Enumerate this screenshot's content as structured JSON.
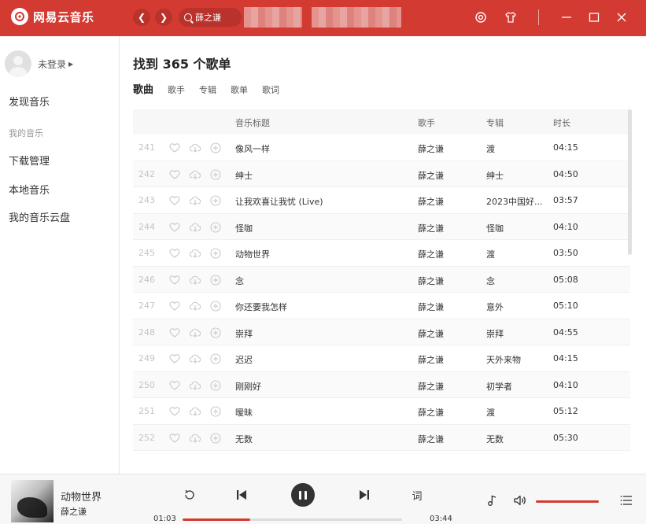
{
  "app": {
    "name": "网易云音乐",
    "accent_color": "#d33a31"
  },
  "search": {
    "query": "薛之谦"
  },
  "sidebar": {
    "login_text": "未登录",
    "discover": "发现音乐",
    "my_music_group": "我的音乐",
    "items": [
      "下载管理",
      "本地音乐",
      "我的音乐云盘"
    ]
  },
  "main": {
    "result_title": "找到 365 个歌单",
    "tabs": [
      "歌曲",
      "歌手",
      "专辑",
      "歌单",
      "歌词"
    ],
    "active_tab": "歌曲",
    "columns": {
      "title": "音乐标题",
      "artist": "歌手",
      "album": "专辑",
      "duration": "时长"
    },
    "rows": [
      {
        "index": "241",
        "title": "像风一样",
        "artist": "薛之谦",
        "album": "渡",
        "duration": "04:15"
      },
      {
        "index": "242",
        "title": "绅士",
        "artist": "薛之谦",
        "album": "绅士",
        "duration": "04:50"
      },
      {
        "index": "243",
        "title": "让我欢喜让我忧 (Live)",
        "artist": "薛之谦",
        "album": "2023中国好...",
        "duration": "03:57"
      },
      {
        "index": "244",
        "title": "怪咖",
        "artist": "薛之谦",
        "album": "怪咖",
        "duration": "04:10"
      },
      {
        "index": "245",
        "title": "动物世界",
        "artist": "薛之谦",
        "album": "渡",
        "duration": "03:50"
      },
      {
        "index": "246",
        "title": "念",
        "artist": "薛之谦",
        "album": "念",
        "duration": "05:08"
      },
      {
        "index": "247",
        "title": "你还要我怎样",
        "artist": "薛之谦",
        "album": "意外",
        "duration": "05:10"
      },
      {
        "index": "248",
        "title": "崇拜",
        "artist": "薛之谦",
        "album": "崇拜",
        "duration": "04:55"
      },
      {
        "index": "249",
        "title": "迟迟",
        "artist": "薛之谦",
        "album": "天外来物",
        "duration": "04:15"
      },
      {
        "index": "250",
        "title": "刚刚好",
        "artist": "薛之谦",
        "album": "初学者",
        "duration": "04:10"
      },
      {
        "index": "251",
        "title": "暧昧",
        "artist": "薛之谦",
        "album": "渡",
        "duration": "05:12"
      },
      {
        "index": "252",
        "title": "无数",
        "artist": "薛之谦",
        "album": "无数",
        "duration": "05:30"
      }
    ]
  },
  "player": {
    "song_name": "动物世界",
    "artist": "薛之谦",
    "current_time": "01:03",
    "total_time": "03:44",
    "lyrics_label": "词",
    "progress_fraction": 0.31,
    "volume_fraction": 1.0
  }
}
